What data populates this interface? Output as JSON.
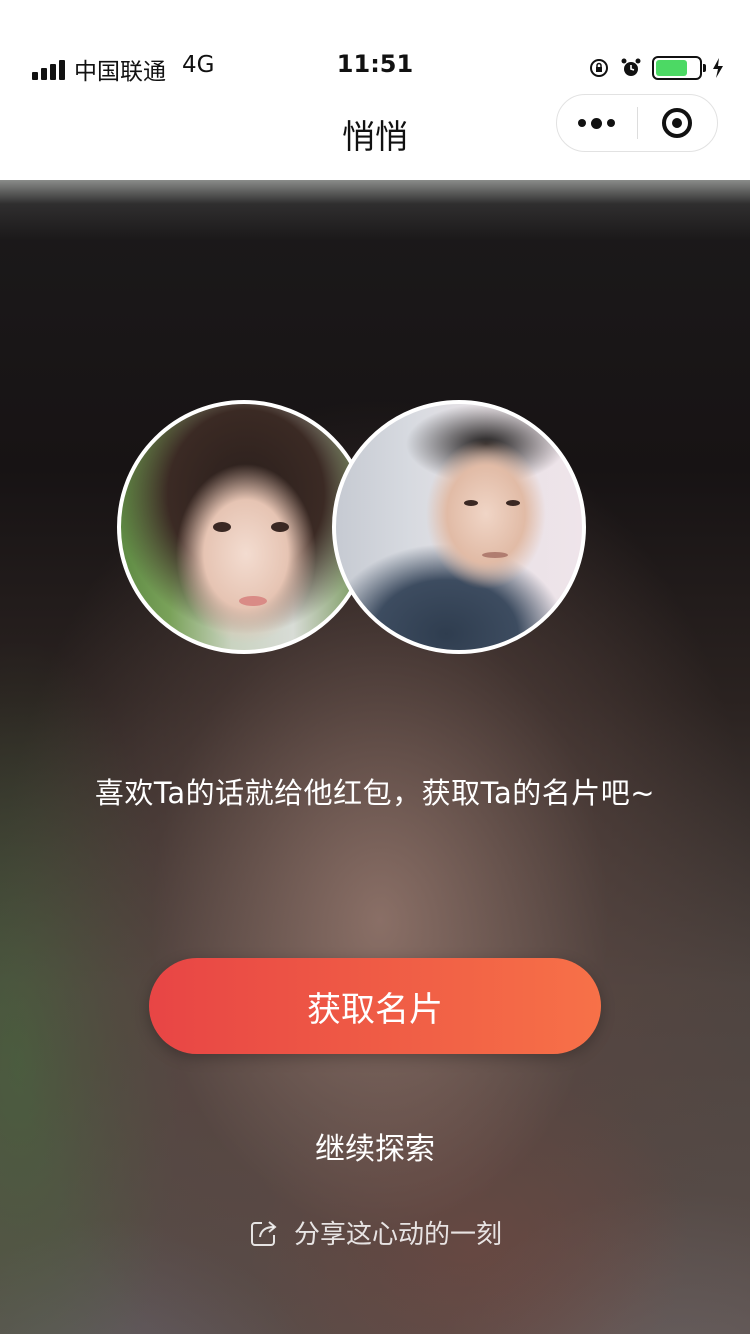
{
  "status_bar": {
    "carrier": "中国联通",
    "network": "4G",
    "time": "11:51",
    "battery_level": 0.75,
    "icons": [
      "signal-icon",
      "rotation-lock-icon",
      "alarm-icon",
      "battery-icon",
      "charging-icon"
    ]
  },
  "nav": {
    "title": "悄悄",
    "menu_icon": "more-dots-icon",
    "close_icon": "target-close-icon"
  },
  "match": {
    "avatars": [
      "avatar-her",
      "avatar-him"
    ],
    "prompt": "喜欢Ta的话就给他红包，获取Ta的名片吧~"
  },
  "actions": {
    "primary_label": "获取名片",
    "secondary_label": "继续探索",
    "share_label": "分享这心动的一刻",
    "share_icon": "share-icon"
  },
  "colors": {
    "button_start": "#e84545",
    "button_end": "#f77148",
    "battery": "#4cd964"
  }
}
